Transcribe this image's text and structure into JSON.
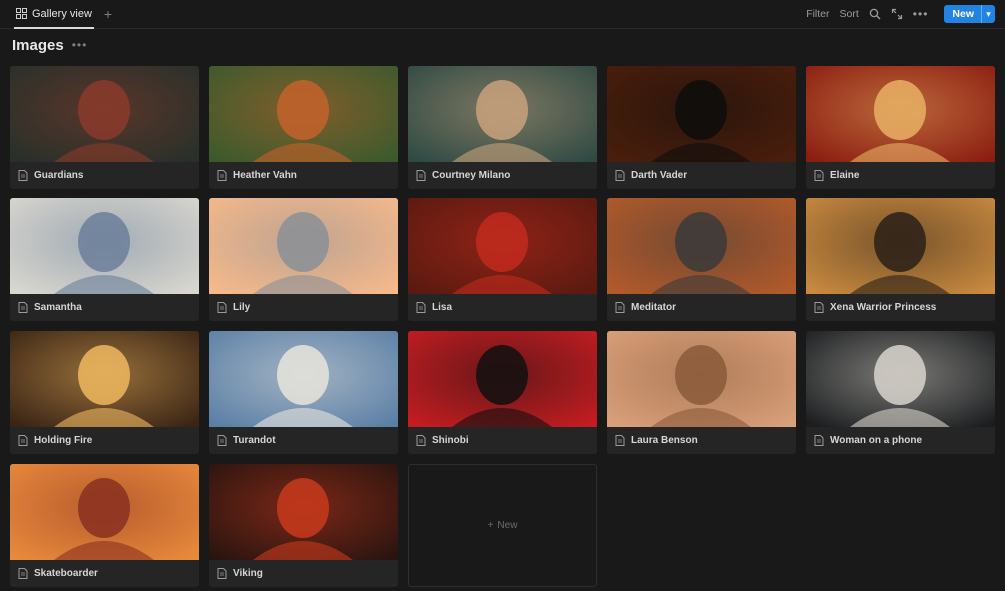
{
  "view_tab": {
    "label": "Gallery view",
    "icon": "grid-icon"
  },
  "toolbar": {
    "filter_label": "Filter",
    "sort_label": "Sort",
    "new_label": "New",
    "accent_color": "#2383e2"
  },
  "page": {
    "title": "Images"
  },
  "new_card_label": "New",
  "cards": [
    {
      "title": "Guardians",
      "bg": "#27302a",
      "fg": "#8a3b2a"
    },
    {
      "title": "Heather Vahn",
      "bg": "#3b5a2c",
      "fg": "#c4612a"
    },
    {
      "title": "Courtney Milano",
      "bg": "#2f4a44",
      "fg": "#c8a27c"
    },
    {
      "title": "Darth Vader",
      "bg": "#4a1e0c",
      "fg": "#0d0d0d"
    },
    {
      "title": "Elaine",
      "bg": "#8b1d10",
      "fg": "#e9b064"
    },
    {
      "title": "Samantha",
      "bg": "#d9d7cf",
      "fg": "#6b7f9a"
    },
    {
      "title": "Lily",
      "bg": "#f6b98b",
      "fg": "#8a8f96"
    },
    {
      "title": "Lisa",
      "bg": "#5a1a10",
      "fg": "#c22a1d"
    },
    {
      "title": "Meditator",
      "bg": "#b35a2a",
      "fg": "#3a3a3a"
    },
    {
      "title": "Xena Warrior Princess",
      "bg": "#c98a3f",
      "fg": "#2a2018"
    },
    {
      "title": "Holding Fire",
      "bg": "#3a2414",
      "fg": "#f0b860"
    },
    {
      "title": "Turandot",
      "bg": "#5a7fa6",
      "fg": "#e8e4dc"
    },
    {
      "title": "Shinobi",
      "bg": "#c41d21",
      "fg": "#111111"
    },
    {
      "title": "Laura Benson",
      "bg": "#d9a07a",
      "fg": "#8a5a3a"
    },
    {
      "title": "Woman on a phone",
      "bg": "#1b1d1f",
      "fg": "#d8d4cc"
    },
    {
      "title": "Skateboarder",
      "bg": "#e88a3c",
      "fg": "#8a3020"
    },
    {
      "title": "Viking",
      "bg": "#2a1410",
      "fg": "#c83a1c"
    }
  ]
}
